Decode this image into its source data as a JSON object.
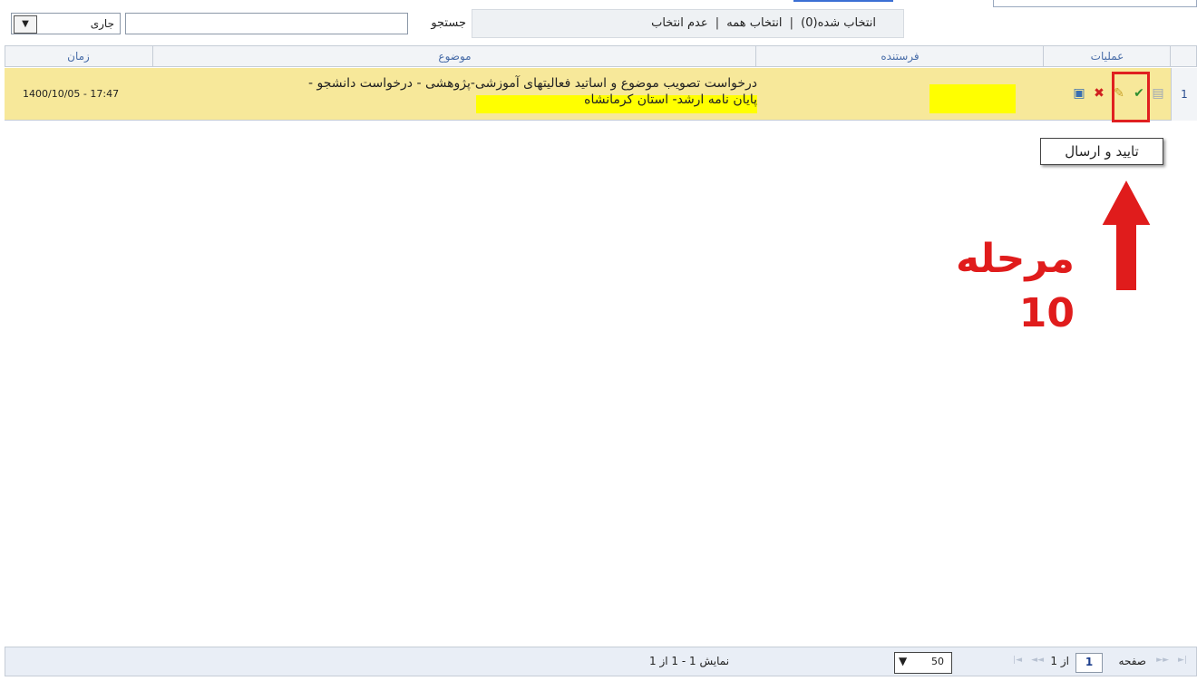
{
  "toolbar": {
    "selected_label": "انتخاب شده(0)",
    "select_all": "انتخاب همه",
    "deselect": "عدم انتخاب",
    "separator": "|",
    "search_label": "جستجو",
    "search_value": "",
    "status_value": "جاری",
    "dropdown_icon": "chevron-down-icon"
  },
  "grid": {
    "columns": {
      "operations": "عملیات",
      "sender": "فرستنده",
      "subject": "موضوع",
      "time": "زمان"
    },
    "rows": [
      {
        "index": "1",
        "subject_line1": "درخواست تصویب موضوع و اساتید فعالیتهای آموزشی-پژوهشی - درخواست دانشجو -",
        "subject_line2": "پایان نامه ارشد- استان کرمانشاه",
        "sender": "",
        "time": "1400/10/05 - 17:47",
        "operation_icons": [
          "document-icon",
          "approve-send-icon",
          "edit-icon",
          "delete-icon",
          "view-icon"
        ]
      }
    ]
  },
  "tooltip": {
    "text": "تایید و ارسال"
  },
  "annotation": {
    "step_text": "مرحله 10",
    "highlight_color": "#e02020"
  },
  "footer": {
    "page_label": "صفحه",
    "page_number": "1",
    "of_label": "از 1",
    "page_size": "50",
    "showing": "نمایش 1 - 1 از 1"
  }
}
